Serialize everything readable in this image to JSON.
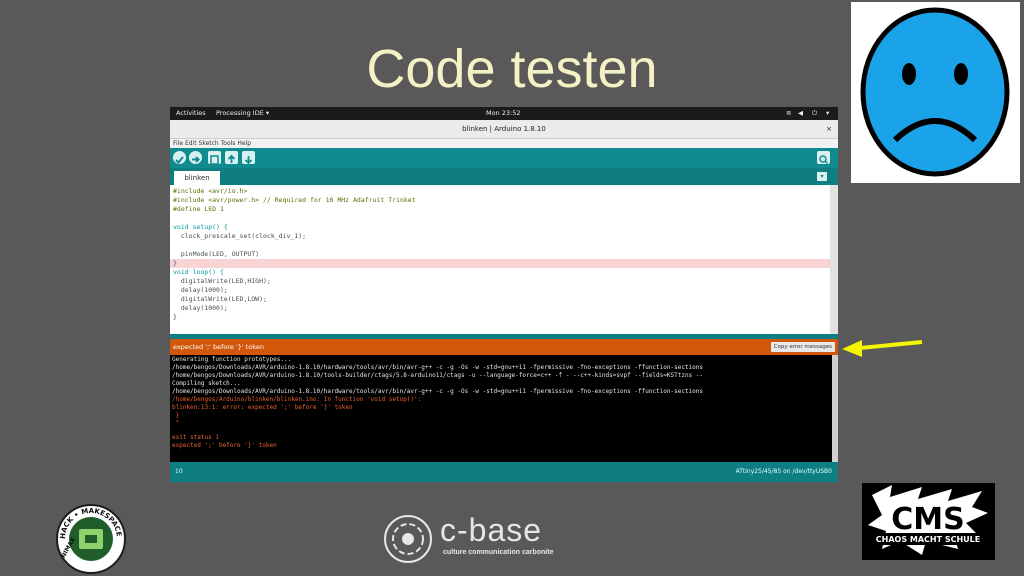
{
  "slide": {
    "title": "Code testen",
    "arrow_color": "#f5f500",
    "background": "#595959"
  },
  "gnome_bar": {
    "activities": "Activities",
    "app_menu": "Processing IDE ▾",
    "clock": "Mon 23:52",
    "tray_icons": [
      "wifi-icon",
      "volume-icon",
      "power-icon",
      "chevron-down-icon"
    ]
  },
  "window": {
    "title": "blinken | Arduino 1.8.10",
    "close_label": "×"
  },
  "menu": {
    "items": [
      "File",
      "Edit",
      "Sketch",
      "Tools",
      "Help"
    ]
  },
  "toolbar": {
    "buttons": [
      "verify-button",
      "upload-button",
      "new-button",
      "open-button",
      "save-button"
    ],
    "serial_monitor_icon": "serial-monitor-icon",
    "accent": "#0f8a8f"
  },
  "tabs": {
    "active": "blinken"
  },
  "editor": {
    "lines": [
      "#include <avr/io.h>",
      "#include <avr/power.h> // Required for 16 MHz Adafruit Trinket",
      "#define LED 1",
      "",
      "void setup() {",
      "  clock_prescale_set(clock_div_1);",
      "",
      "  pinMode(LED, OUTPUT)",
      "}",
      "void loop() {",
      "  digitalWrite(LED,HIGH);",
      "  delay(1000);",
      "  digitalWrite(LED,LOW);",
      "  delay(1000);",
      "}"
    ],
    "error_line_index": 8
  },
  "error": {
    "message": "expected ';' before '}' token",
    "copy_button": "Copy error messages",
    "color": "#d2570a"
  },
  "console": {
    "lines": [
      "Generating function prototypes...",
      "/home/bengos/Downloads/AVR/arduino-1.8.10/hardware/tools/avr/bin/avr-g++ -c -g -Os -w -std=gnu++11 -fpermissive -fno-exceptions -ffunction-sections",
      "/home/bengos/Downloads/AVR/arduino-1.8.10/tools-builder/ctags/5.8-arduino11/ctags -u --language-force=c++ -f - --c++-kinds=svpf --fields=KSTtzns --",
      "Compiling sketch...",
      "/home/bengos/Downloads/AVR/arduino-1.8.10/hardware/tools/avr/bin/avr-g++ -c -g -Os -w -std=gnu++11 -fpermissive -fno-exceptions -ffunction-sections",
      "/home/bengos/Arduino/blinken/blinken.ino: In function 'void setup()':",
      "blinken:13:1: error: expected ';' before '}' token",
      " }",
      " ^",
      "exit status 1",
      "expected ';' before '}' token"
    ],
    "error_start": 5
  },
  "statusbar": {
    "line": "10",
    "board": "ATtiny25/45/85 on /dev/ttyUSB0"
  },
  "logos": {
    "hack": "HACK • MAKESPACE",
    "hack_side": "NIMAX",
    "cbase": "c-base",
    "cbase_tagline": "culture communication carbonite",
    "cms": "CMS",
    "cms_tagline": "CHAOS MACHT SCHULE"
  }
}
